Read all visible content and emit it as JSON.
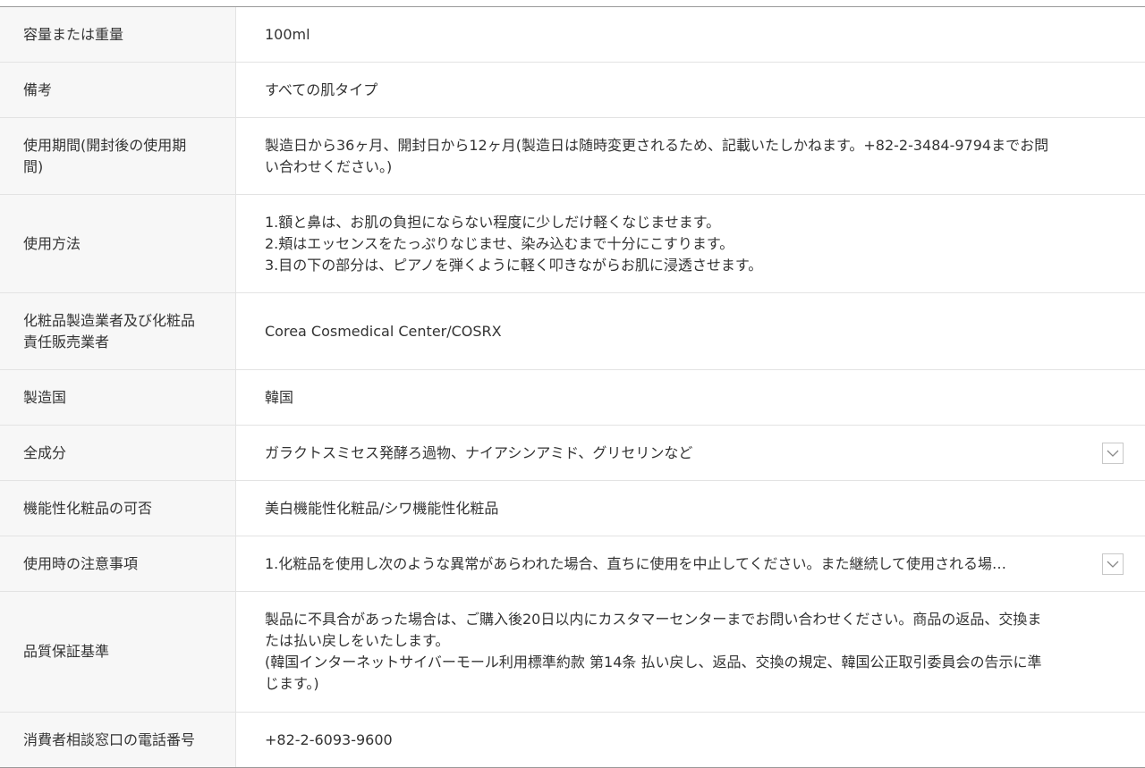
{
  "rows": [
    {
      "label": "容量または重量",
      "value": "100ml"
    },
    {
      "label": "備考",
      "value": "すべての肌タイプ"
    },
    {
      "label": "使用期間(開封後の使用期\n間)",
      "value": "製造日から36ヶ月、開封日から12ヶ月(製造日は随時変更されるため、記載いたしかねます。+82-2-3484-9794までお問\nい合わせください。)"
    },
    {
      "label": "使用方法",
      "value": "1.額と鼻は、お肌の負担にならない程度に少しだけ軽くなじませます。\n2.頬はエッセンスをたっぷりなじませ、染み込むまで十分にこすります。\n3.目の下の部分は、ピアノを弾くように軽く叩きながらお肌に浸透させます。"
    },
    {
      "label": "化粧品製造業者及び化粧品\n責任販売業者",
      "value": "Corea Cosmedical Center/COSRX"
    },
    {
      "label": "製造国",
      "value": "韓国"
    },
    {
      "label": "全成分",
      "value": "ガラクトスミセス発酵ろ過物、ナイアシンアミド、グリセリンなど",
      "toggle_icon": "chevron-down-icon"
    },
    {
      "label": "機能性化粧品の可否",
      "value": "美白機能性化粧品/シワ機能性化粧品"
    },
    {
      "label": "使用時の注意事項",
      "value": "1.化粧品を使用し次のような異常があらわれた場合、直ちに使用を中止してください。また継続して使用される場…",
      "toggle_icon": "chevron-down-icon"
    },
    {
      "label": "品質保証基準",
      "value": "製品に不具合があった場合は、ご購入後20日以内にカスタマーセンターまでお問い合わせください。商品の返品、交換ま\nたは払い戻しをいたします。\n(韓国インターネットサイバーモール利用標準約款 第14条 払い戻し、返品、交換の規定、韓国公正取引委員会の告示に準\nじます。)"
    },
    {
      "label": "消費者相談窓口の電話番号",
      "value": "+82-2-6093-9600"
    }
  ],
  "colors": {
    "label_background": "#f7f7f7",
    "border": "#e3e3e3",
    "outer_border": "#9a9a9a",
    "text": "#333333",
    "toggle_border": "#c8c8c8",
    "toggle_chevron": "#888888"
  }
}
